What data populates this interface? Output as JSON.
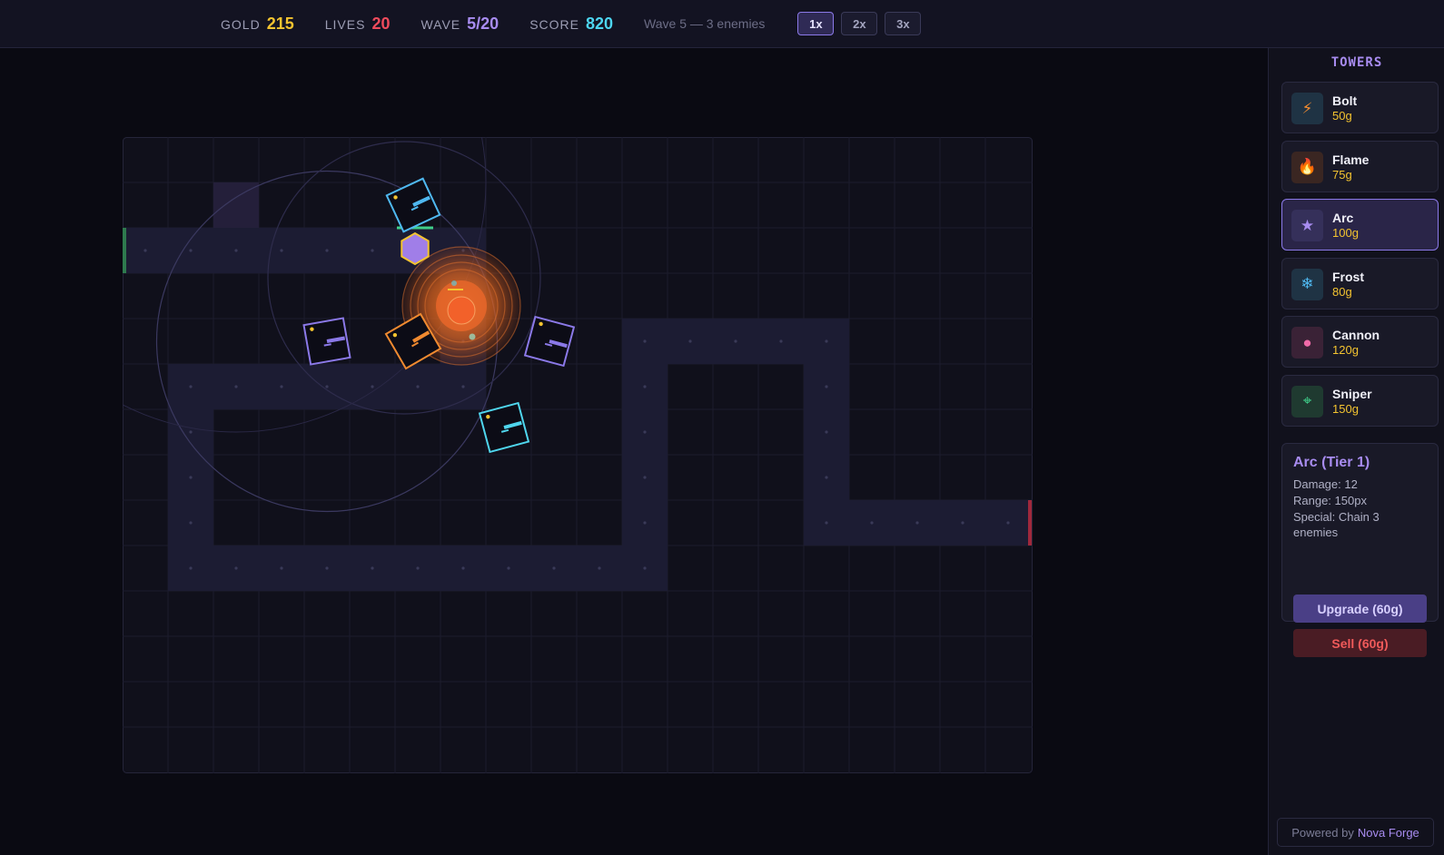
{
  "hud": {
    "gold_label": "GOLD",
    "gold": "215",
    "lives_label": "LIVES",
    "lives": "20",
    "wave_label": "WAVE",
    "wave": "5/20",
    "score_label": "SCORE",
    "score": "820",
    "wave_info": "Wave 5 — 3 enemies",
    "speeds": [
      "1x",
      "2x",
      "3x"
    ],
    "active_speed": "1x"
  },
  "colors": {
    "gold": "#f4c430",
    "lives": "#ef4b5c",
    "wave": "#a88cf0",
    "score": "#4dd6f0",
    "arc": "#8b79e8",
    "bolt": "#4fb8f0",
    "flame": "#f08a30",
    "frost": "#4fd6ee",
    "path": "#1c1c33",
    "exit": "#a0283c",
    "entry": "#2e7a4e"
  },
  "board": {
    "cols": 20,
    "rows": 14,
    "path_cells": [
      [
        0,
        2
      ],
      [
        1,
        2
      ],
      [
        2,
        2
      ],
      [
        3,
        2
      ],
      [
        4,
        2
      ],
      [
        5,
        2
      ],
      [
        6,
        2
      ],
      [
        7,
        2
      ],
      [
        7,
        3
      ],
      [
        7,
        4
      ],
      [
        7,
        5
      ],
      [
        6,
        5
      ],
      [
        5,
        5
      ],
      [
        4,
        5
      ],
      [
        3,
        5
      ],
      [
        2,
        5
      ],
      [
        1,
        5
      ],
      [
        1,
        6
      ],
      [
        1,
        7
      ],
      [
        1,
        8
      ],
      [
        1,
        9
      ],
      [
        2,
        9
      ],
      [
        3,
        9
      ],
      [
        4,
        9
      ],
      [
        5,
        9
      ],
      [
        6,
        9
      ],
      [
        7,
        9
      ],
      [
        8,
        9
      ],
      [
        9,
        9
      ],
      [
        10,
        9
      ],
      [
        11,
        9
      ],
      [
        11,
        8
      ],
      [
        11,
        7
      ],
      [
        11,
        6
      ],
      [
        11,
        5
      ],
      [
        11,
        4
      ],
      [
        12,
        4
      ],
      [
        13,
        4
      ],
      [
        14,
        4
      ],
      [
        15,
        4
      ],
      [
        15,
        5
      ],
      [
        15,
        6
      ],
      [
        15,
        7
      ],
      [
        15,
        8
      ],
      [
        16,
        8
      ],
      [
        17,
        8
      ],
      [
        18,
        8
      ],
      [
        19,
        8
      ]
    ],
    "highlight_cell": [
      2,
      1
    ],
    "towers": [
      {
        "type": "bolt",
        "name": "bolt-tower",
        "col": 6.4,
        "row": 1.5,
        "angle": -25
      },
      {
        "type": "arc",
        "name": "arc-tower",
        "col": 4.5,
        "row": 4.5,
        "angle": -10
      },
      {
        "type": "flame",
        "name": "flame-tower",
        "col": 6.4,
        "row": 4.5,
        "angle": -30
      },
      {
        "type": "arc",
        "name": "arc-tower",
        "col": 9.4,
        "row": 4.5,
        "angle": 15
      },
      {
        "type": "frost",
        "name": "frost-tower",
        "col": 8.4,
        "row": 6.4,
        "angle": -15
      }
    ],
    "enemies": [
      {
        "type": "hexagon",
        "col": 6.5,
        "row": 2.5
      },
      {
        "type": "burning",
        "col": 7.5,
        "row": 3.8
      }
    ],
    "range_circle": {
      "col": 4.5,
      "row": 4.5,
      "radius_cells": 3.75
    }
  },
  "sidebar": {
    "title": "TOWERS",
    "towers": [
      {
        "name": "Bolt",
        "cost": "50g",
        "icon": "lightning-icon",
        "glyph": "⚡",
        "bg": "#1f3344",
        "color": "#f08a30"
      },
      {
        "name": "Flame",
        "cost": "75g",
        "icon": "flame-icon",
        "glyph": "🔥",
        "bg": "#3a2622",
        "color": "#f08a30"
      },
      {
        "name": "Arc",
        "cost": "100g",
        "icon": "star-icon",
        "glyph": "★",
        "bg": "#35305a",
        "color": "#a88cf0"
      },
      {
        "name": "Frost",
        "cost": "80g",
        "icon": "snowflake-icon",
        "glyph": "❄",
        "bg": "#1f3344",
        "color": "#4fb8f0"
      },
      {
        "name": "Cannon",
        "cost": "120g",
        "icon": "dot-icon",
        "glyph": "●",
        "bg": "#3a2236",
        "color": "#f06aa8"
      },
      {
        "name": "Sniper",
        "cost": "150g",
        "icon": "crosshair-icon",
        "glyph": "⌖",
        "bg": "#1f3a30",
        "color": "#3fcf8a"
      }
    ],
    "selected": "Arc",
    "info": {
      "title": "Arc (Tier 1)",
      "damage": "Damage: 12",
      "range": "Range: 150px",
      "special": "Special: Chain 3 enemies",
      "upgrade": "Upgrade (60g)",
      "sell": "Sell (60g)"
    },
    "credit_prefix": "Powered by",
    "credit_brand": "Nova Forge"
  }
}
